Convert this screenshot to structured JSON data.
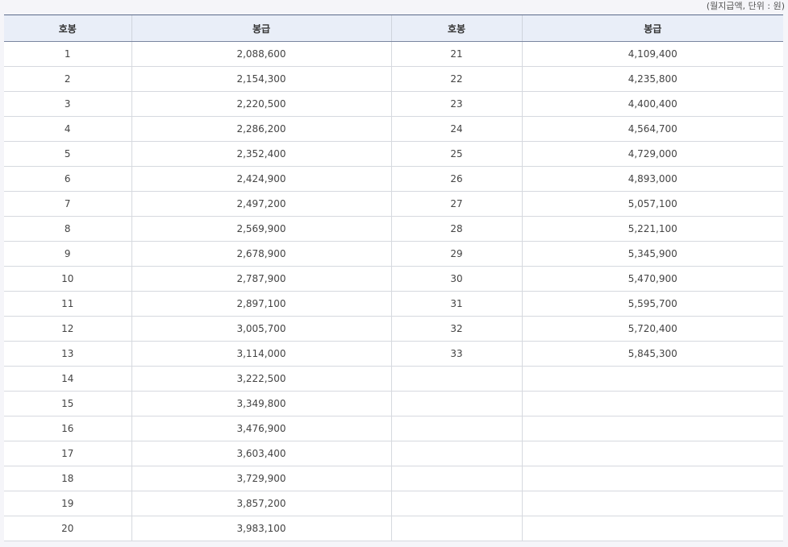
{
  "unit_note": "(월지급액, 단위 : 원)",
  "headers": [
    "호봉",
    "봉급",
    "호봉",
    "봉급"
  ],
  "rows": [
    [
      "1",
      "2,088,600",
      "21",
      "4,109,400"
    ],
    [
      "2",
      "2,154,300",
      "22",
      "4,235,800"
    ],
    [
      "3",
      "2,220,500",
      "23",
      "4,400,400"
    ],
    [
      "4",
      "2,286,200",
      "24",
      "4,564,700"
    ],
    [
      "5",
      "2,352,400",
      "25",
      "4,729,000"
    ],
    [
      "6",
      "2,424,900",
      "26",
      "4,893,000"
    ],
    [
      "7",
      "2,497,200",
      "27",
      "5,057,100"
    ],
    [
      "8",
      "2,569,900",
      "28",
      "5,221,100"
    ],
    [
      "9",
      "2,678,900",
      "29",
      "5,345,900"
    ],
    [
      "10",
      "2,787,900",
      "30",
      "5,470,900"
    ],
    [
      "11",
      "2,897,100",
      "31",
      "5,595,700"
    ],
    [
      "12",
      "3,005,700",
      "32",
      "5,720,400"
    ],
    [
      "13",
      "3,114,000",
      "33",
      "5,845,300"
    ],
    [
      "14",
      "3,222,500",
      "",
      ""
    ],
    [
      "15",
      "3,349,800",
      "",
      ""
    ],
    [
      "16",
      "3,476,900",
      "",
      ""
    ],
    [
      "17",
      "3,603,400",
      "",
      ""
    ],
    [
      "18",
      "3,729,900",
      "",
      ""
    ],
    [
      "19",
      "3,857,200",
      "",
      ""
    ],
    [
      "20",
      "3,983,100",
      "",
      ""
    ]
  ]
}
